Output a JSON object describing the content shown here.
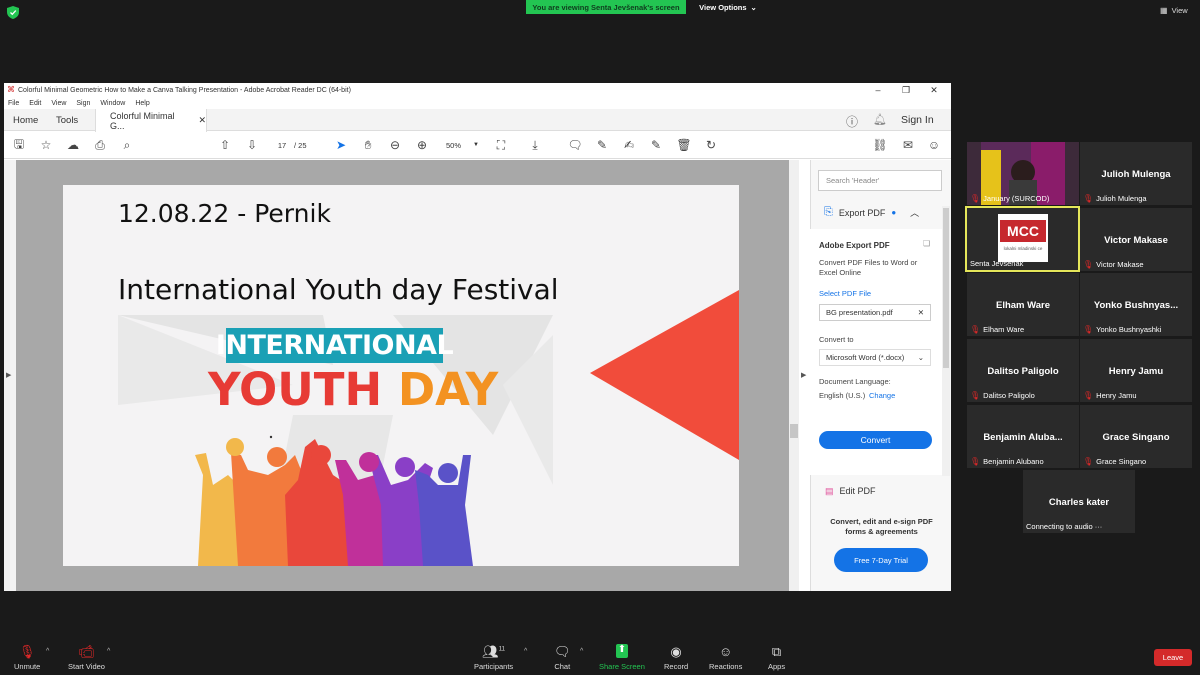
{
  "zoom_top": {
    "banner": "You are viewing Senta Jevšenak's screen",
    "view_options": "View Options",
    "view": "View"
  },
  "acrobat": {
    "title": "Colorful Minimal Geometric How to Make a Canva Talking Presentation - Adobe Acrobat Reader DC (64-bit)",
    "menu": [
      "File",
      "Edit",
      "View",
      "Sign",
      "Window",
      "Help"
    ],
    "tabs": {
      "home": "Home",
      "tools": "Tools",
      "doc": "Colorful Minimal G..."
    },
    "sign_in": "Sign In",
    "page_current": "17",
    "page_total": "/  25",
    "zoom": "50%"
  },
  "slide": {
    "date": "12.08.22 - Pernik",
    "title": "International Youth day Festival",
    "banner": "INTERNATIONAL",
    "youth_word": "YOUTH",
    "day_word": "DAY"
  },
  "panel": {
    "search_placeholder": "Search 'Header'",
    "export_label": "Export PDF",
    "heading": "Adobe Export PDF",
    "desc": "Convert PDF Files to Word or Excel Online",
    "select_file": "Select PDF File",
    "file_name": "BG presentation.pdf",
    "convert_to": "Convert to",
    "format": "Microsoft Word (*.docx)",
    "doc_lang_label": "Document Language:",
    "doc_lang": "English (U.S.)",
    "change": "Change",
    "convert_btn": "Convert",
    "edit_pdf": "Edit PDF",
    "trial_text": "Convert, edit and e-sign PDF forms & agreements",
    "trial_btn": "Free 7-Day Trial"
  },
  "participants": [
    {
      "label": "January (SURCOD)",
      "name": "",
      "video": true
    },
    {
      "label": "Julioh Mulenga",
      "name": "Julioh Mulenga"
    },
    {
      "label": "Senta Jevšenak",
      "name": "",
      "active": true,
      "logo": "MCC",
      "logo_sub": "lokalni mladinski ce"
    },
    {
      "label": "Victor Makase",
      "name": "Victor Makase"
    },
    {
      "label": "Elham Ware",
      "name": "Elham Ware"
    },
    {
      "label": "Yonko Bushnyashki",
      "name": "Yonko  Bushnyas..."
    },
    {
      "label": "Dalitso Paligolo",
      "name": "Dalitso Paligolo"
    },
    {
      "label": "Henry Jamu",
      "name": "Henry Jamu"
    },
    {
      "label": "Benjamin Alubano",
      "name": "Benjamin  Aluba..."
    },
    {
      "label": "Grace Singano",
      "name": "Grace Singano"
    },
    {
      "label": "Connecting to audio ···",
      "name": "Charles kater"
    }
  ],
  "bottom": {
    "unmute": "Unmute",
    "start_video": "Start Video",
    "participants": "Participants",
    "participants_count": "11",
    "chat": "Chat",
    "share_screen": "Share Screen",
    "record": "Record",
    "reactions": "Reactions",
    "apps": "Apps",
    "leave": "Leave"
  }
}
